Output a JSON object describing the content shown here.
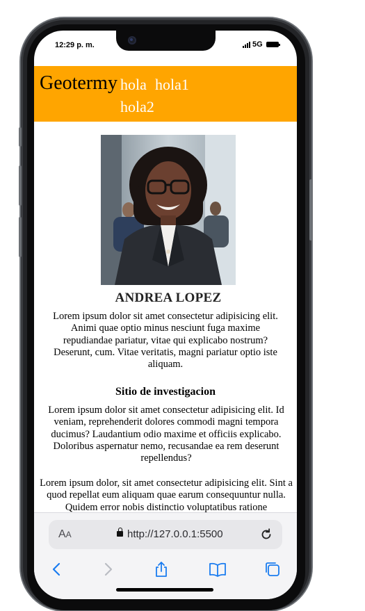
{
  "status_bar": {
    "time": "12:29 p. m.",
    "network": "5G"
  },
  "site": {
    "brand": "Geotermy",
    "nav": [
      "hola",
      "hola1",
      "hola2"
    ]
  },
  "profile": {
    "name": "ANDREA LOPEZ",
    "bio": "Lorem ipsum dolor sit amet consectetur adipisicing elit. Animi quae optio minus nesciunt fuga maxime repudiandae pariatur, vitae qui explicabo nostrum? Deserunt, cum. Vitae veritatis, magni pariatur optio iste aliquam."
  },
  "section": {
    "title": "Sitio de investigacion",
    "text": "Lorem ipsum dolor sit amet consectetur adipisicing elit. Id veniam, reprehenderit dolores commodi magni tempora ducimus? Laudantium odio maxime et officiis explicabo. Doloribus aspernatur nemo, recusandae ea rem deserunt repellendus?",
    "text2": "Lorem ipsum dolor, sit amet consectetur adipisicing elit. Sint a quod repellat eum aliquam quae earum consequuntur nulla. Quidem error nobis distinctio voluptatibus ratione"
  },
  "browser": {
    "text_size_big": "A",
    "text_size_small": "A",
    "url": "http://127.0.0.1:5500"
  },
  "icons": [
    "signal-icon",
    "battery-icon",
    "lock-icon",
    "reload-icon",
    "back-icon",
    "forward-icon",
    "share-icon",
    "bookmarks-icon",
    "tabs-icon"
  ],
  "colors": {
    "header": "#ffa500",
    "link": "#ffffff",
    "toolbar_blue": "#1a7cf0"
  }
}
